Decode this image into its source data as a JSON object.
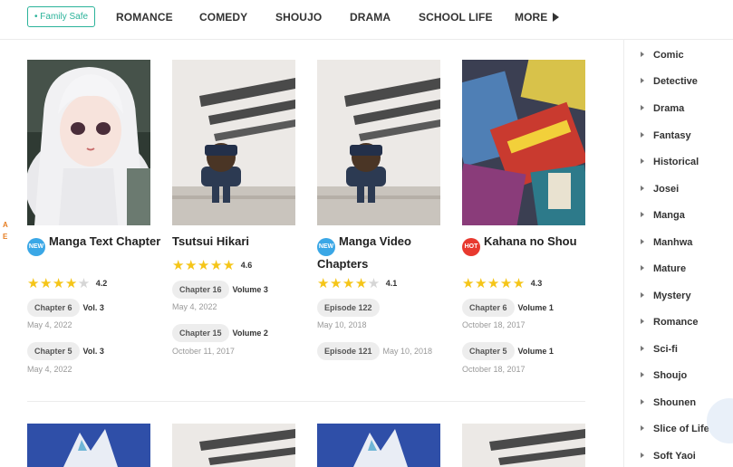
{
  "nav": {
    "family_safe": "• Family Safe",
    "items": [
      "ROMANCE",
      "COMEDY",
      "SHOUJO",
      "DRAMA",
      "SCHOOL LIFE"
    ],
    "more": "MORE",
    "accent_color": "#2bb39a"
  },
  "edge_marks": [
    "A",
    "E"
  ],
  "cards": [
    {
      "badge": "NEW",
      "title": "Manga Text Chapter",
      "rating": 4.2,
      "rating_label": "4.2",
      "chapters": [
        {
          "label": "Chapter 6",
          "volume": "Vol. 3",
          "date": "May 4, 2022"
        },
        {
          "label": "Chapter 5",
          "volume": "Vol. 3",
          "date": "May 4, 2022"
        }
      ]
    },
    {
      "badge": "",
      "title": "Tsutsui Hikari",
      "rating": 4.6,
      "rating_label": "4.6",
      "chapters": [
        {
          "label": "Chapter 16",
          "volume": "Volume 3",
          "date": "May 4, 2022"
        },
        {
          "label": "Chapter 15",
          "volume": "Volume 2",
          "date": "October 11, 2017"
        }
      ]
    },
    {
      "badge": "NEW",
      "title": "Manga Video Chapters",
      "rating": 4.1,
      "rating_label": "4.1",
      "chapters": [
        {
          "label": "Episode 122",
          "volume": "",
          "date": "May 10, 2018"
        },
        {
          "label": "Episode 121",
          "volume": "",
          "date": "May 10, 2018"
        }
      ]
    },
    {
      "badge": "HOT",
      "title": "Kahana no Shou",
      "rating": 4.3,
      "rating_label": "4.3",
      "chapters": [
        {
          "label": "Chapter 6",
          "volume": "Volume 1",
          "date": "October 18, 2017"
        },
        {
          "label": "Chapter 5",
          "volume": "Volume 1",
          "date": "October 18, 2017"
        }
      ]
    }
  ],
  "sidebar": {
    "genres": [
      "Comic",
      "Detective",
      "Drama",
      "Fantasy",
      "Historical",
      "Josei",
      "Manga",
      "Manhwa",
      "Mature",
      "Mystery",
      "Romance",
      "Sci-fi",
      "Shoujo",
      "Shounen",
      "Slice of Life",
      "Soft Yaoi"
    ]
  },
  "colors": {
    "star": "#f5c518",
    "new_badge": "#3aa7e6",
    "hot_badge": "#e8392f"
  }
}
